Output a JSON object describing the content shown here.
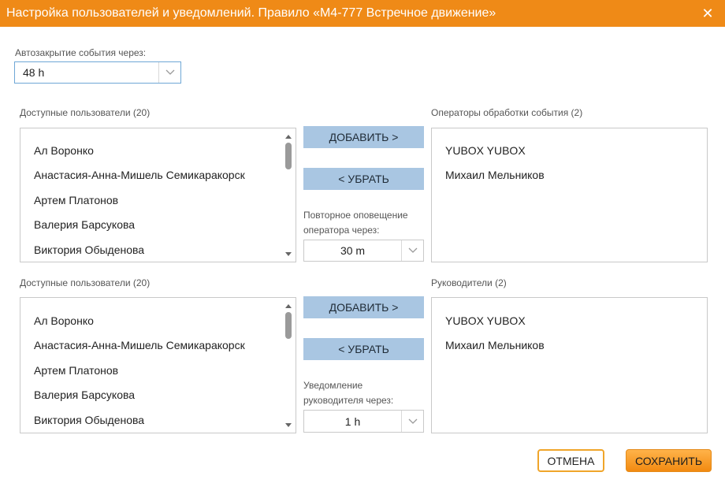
{
  "dialog": {
    "title": "Настройка пользователей и уведомлений. Правило «М4-777 Встречное движение»",
    "close_icon": "close-icon"
  },
  "autoclose": {
    "label": "Автозакрытие события через:",
    "value": "48 h"
  },
  "section1": {
    "available_label": "Доступные пользователи (20)",
    "available_items": [
      "Ал Воронко",
      "Анастасия-Анна-Мишель Семикаракорск",
      "Артем Платонов",
      "Валерия Барсукова",
      "Виктория Обыденова"
    ],
    "add_label": "ДОБАВИТЬ >",
    "remove_label": "< УБРАТЬ",
    "repeat_label_line1": "Повторное оповещение",
    "repeat_label_line2": "оператора через:",
    "repeat_value": "30 m",
    "selected_label": "Операторы обработки события (2)",
    "selected_items": [
      "YUBOX YUBOX",
      "Михаил Мельников"
    ]
  },
  "section2": {
    "available_label": "Доступные пользователи (20)",
    "available_items": [
      "Ал Воронко",
      "Анастасия-Анна-Мишель Семикаракорск",
      "Артем Платонов",
      "Валерия Барсукова",
      "Виктория Обыденова"
    ],
    "add_label": "ДОБАВИТЬ >",
    "remove_label": "< УБРАТЬ",
    "notify_label_line1": "Уведомление",
    "notify_label_line2": "руководителя через:",
    "notify_value": "1 h",
    "selected_label": "Руководители (2)",
    "selected_items": [
      "YUBOX YUBOX",
      "Михаил Мельников"
    ]
  },
  "footer": {
    "cancel_label": "ОТМЕНА",
    "save_label": "СОХРАНИТЬ"
  },
  "colors": {
    "titlebar": "#ef8a17",
    "blue_button": "#a9c6e2",
    "cancel_border": "#f0a52a",
    "save_fill": "#f28a10"
  }
}
